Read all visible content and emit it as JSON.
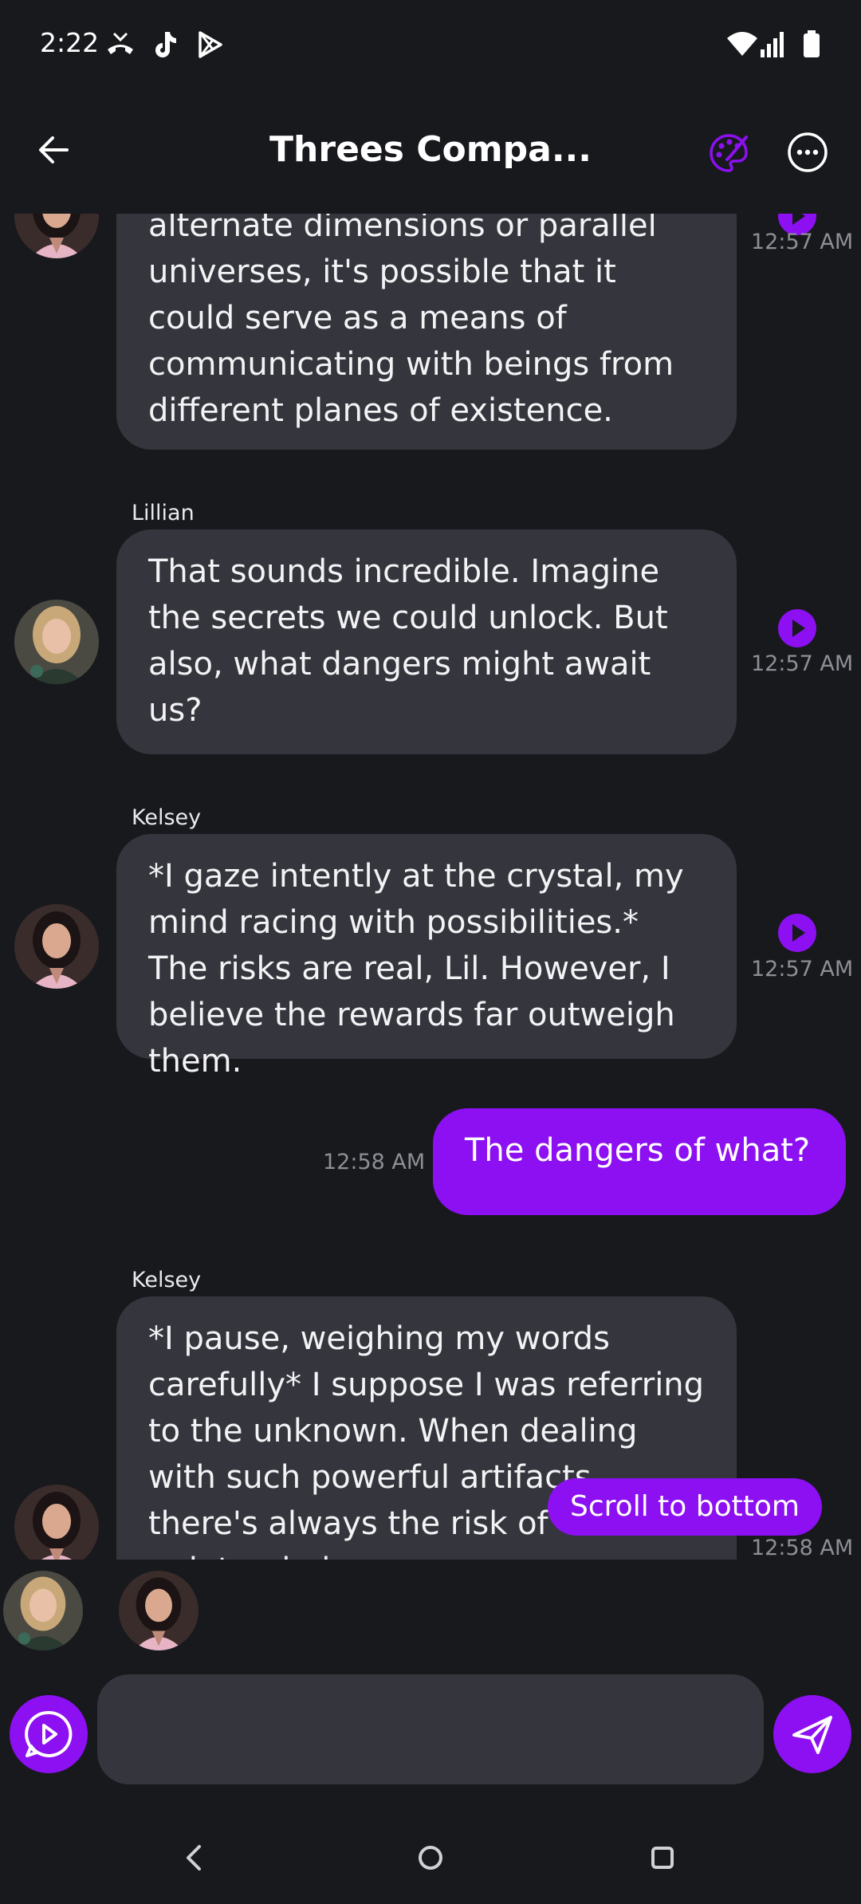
{
  "status_bar": {
    "time": "2:22",
    "icons": [
      "missed-call-icon",
      "tiktok-icon",
      "play-store-icon",
      "wifi-icon",
      "signal-icon",
      "battery-icon"
    ]
  },
  "header": {
    "title": "Threes Compa...",
    "accent_color": "#8c10f2"
  },
  "messages": [
    {
      "sender": "",
      "text": "alternate dimensions or parallel universes, it's possible that it could serve as a means of communicating with beings from different planes of existence.",
      "time": "12:57 AM",
      "mine": false
    },
    {
      "sender": "Lillian",
      "text": "That sounds incredible. Imagine the secrets we could unlock. But also, what dangers might await us?",
      "time": "12:57 AM",
      "mine": false
    },
    {
      "sender": "Kelsey",
      "text": "*I gaze intently at the crystal, my mind racing with possibilities.* The risks are real, Lil. However, I believe the rewards far outweigh them.",
      "time": "12:57 AM",
      "mine": false
    },
    {
      "sender": "",
      "text": "The dangers of what?",
      "time": "12:58 AM",
      "mine": true
    },
    {
      "sender": "Kelsey",
      "text": "*I pause, weighing my words carefully* I suppose I was referring to the unknown. When dealing with such powerful artifacts, there's always the risk of unintended consequences.",
      "time": "12:58 AM",
      "mine": false
    }
  ],
  "scroll_to_bottom_label": "Scroll to bottom",
  "composer": {
    "placeholder": "",
    "value": ""
  }
}
